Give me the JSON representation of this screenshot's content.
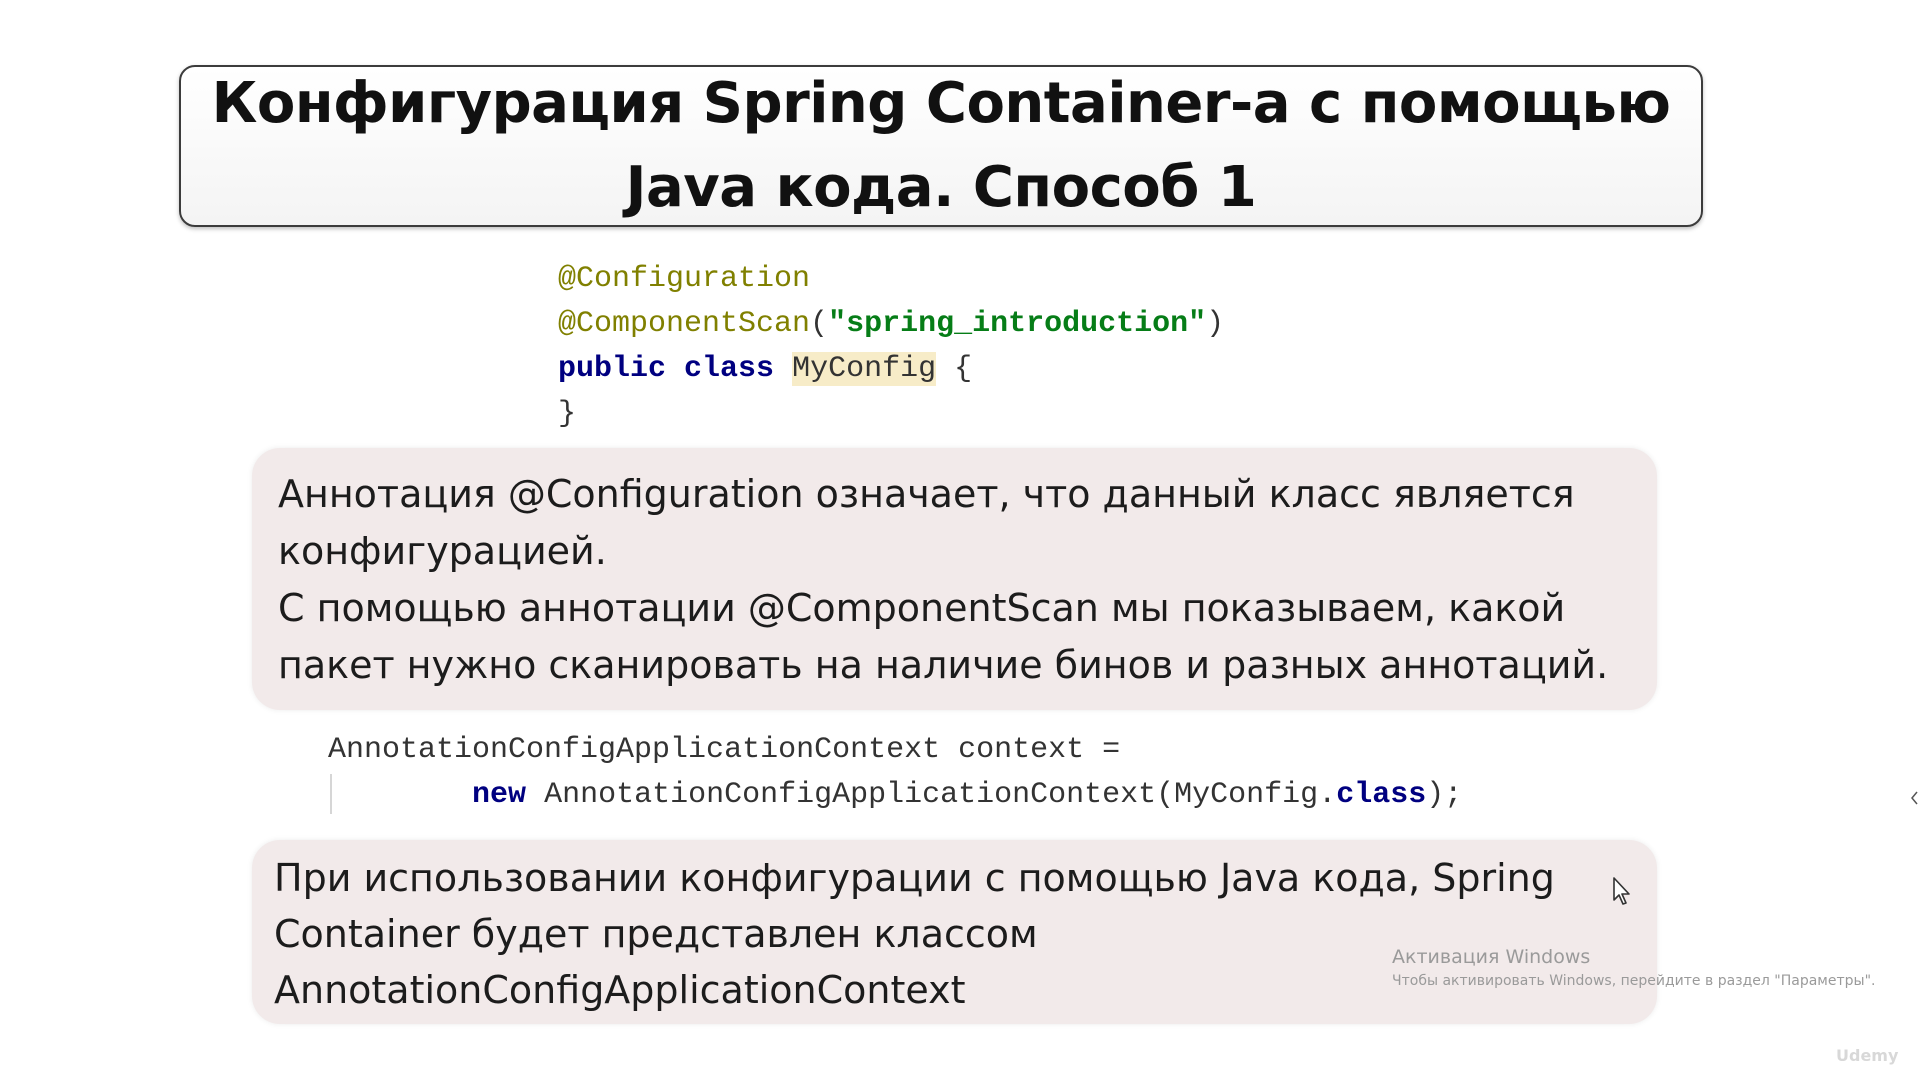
{
  "slide": {
    "title": "Конфигурация Spring Container-а с помощью\nJava кода. Способ 1",
    "code_block_1": {
      "line1_annotation": "@Configuration",
      "line2_annotation": "@ComponentScan",
      "line2_open": "(",
      "line2_string": "\"spring_introduction\"",
      "line2_close": ")",
      "line3_keyword_public": "public",
      "line3_keyword_class": "class",
      "line3_classname": "MyConfig",
      "line3_brace": "{",
      "line4_brace": "}"
    },
    "explanation_1": "Аннотация @Configuration означает, что данный класс является\nконфигурацией.\nС помощью аннотации @ComponentScan мы показываем, какой\nпакет нужно сканировать на наличие бинов и разных аннотаций.",
    "code_block_2": {
      "line1": "AnnotationConfigApplicationContext context =",
      "line2_keyword_new": "new",
      "line2_call": "AnnotationConfigApplicationContext(MyConfig.",
      "line2_keyword_class": "class",
      "line2_end": ");"
    },
    "explanation_2": "При использовании конфигурации с помощью Java кода, Spring\nContainer будет представлен классом\nAnnotationConfigApplicationContext"
  },
  "windows_activation": {
    "title": "Активация Windows",
    "subtitle": "Чтобы активировать Windows, перейдите в раздел \"Параметры\"."
  },
  "watermark": {
    "text": "Udemy"
  },
  "icons": {
    "cursor": "mouse-pointer-icon"
  },
  "colors": {
    "annotation": "#808000",
    "string": "#067d17",
    "keyword": "#000080",
    "highlight": "#f7ecc8",
    "box_bg": "#f2eaea"
  }
}
